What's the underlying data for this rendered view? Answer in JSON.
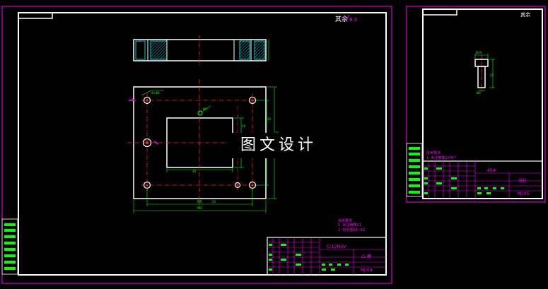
{
  "colors": {
    "background": "#000000",
    "frame": "#ffffff",
    "outer_border": "#ff00ff",
    "center_line": "#ff2020",
    "dimension": "#00ff00",
    "hatch": "#00ffff",
    "title_block_lines": "#ff00ff",
    "title_block_fill": "#00ff00",
    "annotation": "#ff00ff"
  },
  "sheet_main": {
    "roughness_note": "其余",
    "roughness_value": "6.3",
    "tech_req_title": "技术要求",
    "tech_req_items": [
      "1. 未注倒角C1",
      "2. 热处理58~62"
    ],
    "title_block": {
      "material": "Cr12MoV",
      "part_name": "凸  模",
      "drawing_no": "MJ-04"
    },
    "dims": {
      "width": "90",
      "hole_span": "66",
      "hole_span_inner": "50",
      "opening_width": "36",
      "opening_height": "28",
      "height": "70",
      "height_inner": "50",
      "hole_dia": "4×Φ8",
      "pin_dia": "Φ6"
    }
  },
  "sheet_small": {
    "roughness_note": "其余",
    "tech_req_title": "技术要求",
    "tech_req_item": "1. 未注倒角1X45°",
    "title_block": {
      "material": "45#",
      "part_name": "导柱",
      "drawing_no": "MJ-05"
    },
    "dims": {
      "head_dia": "Φ15",
      "length": "25",
      "shank_dia": "Φ8"
    }
  },
  "watermark": "图文设计"
}
